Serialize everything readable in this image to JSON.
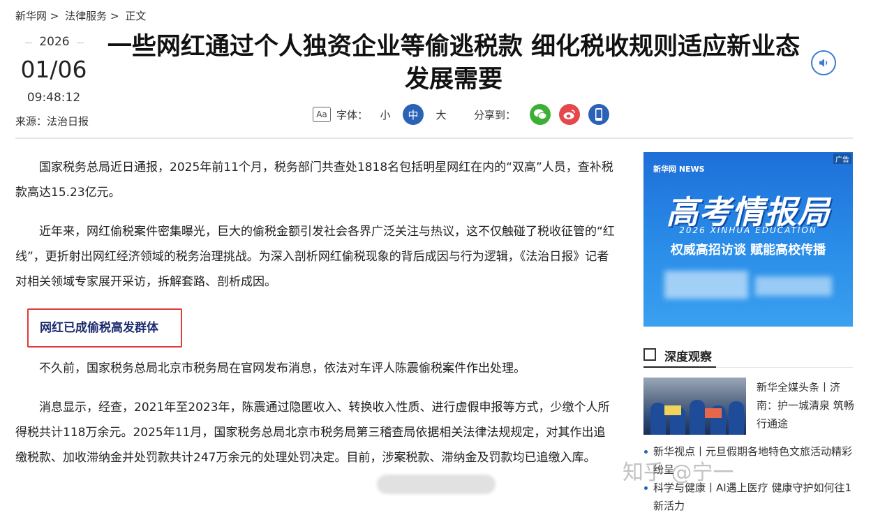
{
  "breadcrumb": [
    "新华网",
    ">",
    "法律服务",
    ">",
    "正文"
  ],
  "date": {
    "year": "2026",
    "month_day": "01/06",
    "time": "09:48:12"
  },
  "source": "来源：法治日报",
  "title": "一些网红通过个人独资企业等偷逃税款 细化税收规则适应新业态发展需要",
  "toolbar": {
    "font_icon": "Aa",
    "font_label": "字体：",
    "font_sizes": [
      "小",
      "中",
      "大"
    ],
    "font_size_selected": "中",
    "share_label": "分享到：",
    "share_icons": [
      "wechat-icon",
      "weibo-icon",
      "mobile-icon"
    ]
  },
  "article": {
    "p1": "国家税务总局近日通报，2025年前11个月，税务部门共查处1818名包括明星网红在内的“双高”人员，查补税款高达15.23亿元。",
    "p2": "近年来，网红偷税案件密集曝光，巨大的偷税金额引发社会各界广泛关注与热议，这不仅触碰了税收征管的“红线”，更折射出网红经济领域的税务治理挑战。为深入剖析网红偷税现象的背后成因与行为逻辑，《法治日报》记者对相关领域专家展开采访，拆解套路、剖析成因。",
    "subheading": "网红已成偷税高发群体",
    "p3": "不久前，国家税务总局北京市税务局在官网发布消息，依法对车评人陈震偷税案件作出处理。",
    "p4": "消息显示，经查，2021年至2023年，陈震通过隐匿收入、转换收入性质、进行虚假申报等方式，少缴个人所得税共计118万余元。2025年11月，国家税务总局北京市税务局第三稽查局依据相关法律法规规定，对其作出追缴税款、加收滞纳金并处罚款共计247万余元的处理处罚决定。目前，涉案税款、滞纳金及罚款均已追缴入库。"
  },
  "ad": {
    "tag": "广告",
    "logo": "新华网 NEWS",
    "title": "高考情报局",
    "subtitle": "2026 XINHUA EDUCATION",
    "slogan": "权威高招访谈 赋能高校传播"
  },
  "sidebar": {
    "section_title": "深度观察",
    "featured": "新华全媒头条丨济南：护一城清泉 筑畅行通途",
    "items": [
      "新华视点丨元旦假期各地特色文旅活动精彩纷呈",
      "科学与健康丨AI遇上医疗 健康守护如何往1新活力"
    ]
  },
  "watermark": "知乎 @宁一",
  "colors": {
    "accent": "#2a62b8",
    "highlight_border": "#e03a3a",
    "subheading": "#1a2a6e"
  }
}
